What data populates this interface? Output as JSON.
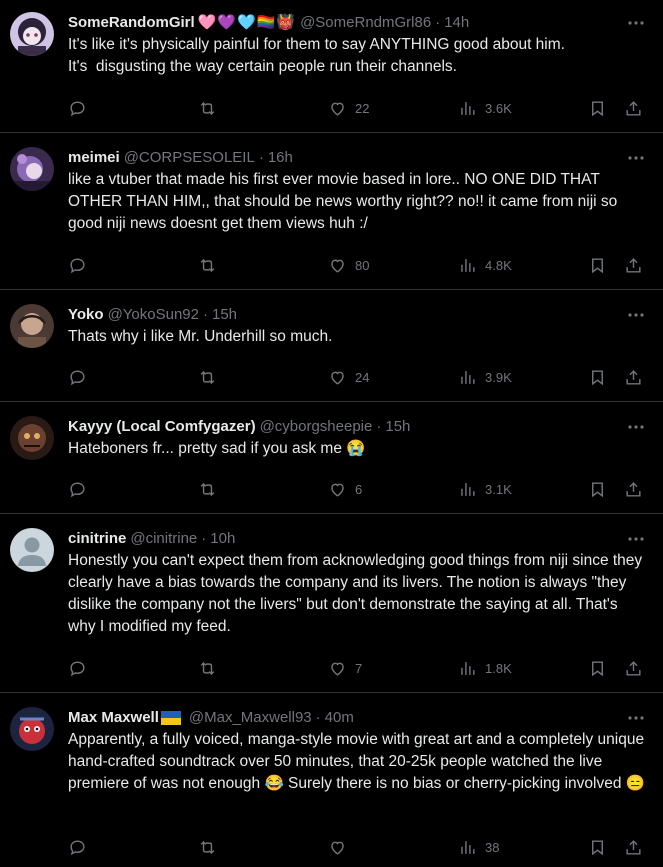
{
  "tweets": [
    {
      "name": "SomeRandomGirl",
      "name_emojis": "🩷💜🩵🏳️‍🌈👹",
      "handle": "@SomeRndmGrl86",
      "time": "14h",
      "text": "It's like it's physically painful for them to say ANYTHING good about him.\nIt's  disgusting the way certain people run their channels.",
      "replies": "",
      "retweets": "",
      "likes": "22",
      "views": "3.6K",
      "avatar_color": "#b9a7d6"
    },
    {
      "name": "meimei",
      "name_emojis": "",
      "handle": "@CORPSESOLEIL",
      "time": "16h",
      "text": "like a vtuber that made his first ever movie based in lore.. NO ONE DID THAT OTHER THAN HIM,, that should be news worthy right?? no!! it came from niji so good niji news doesnt get them views huh :/",
      "replies": "",
      "retweets": "",
      "likes": "80",
      "views": "4.8K",
      "avatar_color": "#6b4d8f"
    },
    {
      "name": "Yoko",
      "name_emojis": "",
      "handle": "@YokoSun92",
      "time": "15h",
      "text": "Thats why i like Mr. Underhill so much.",
      "replies": "",
      "retweets": "",
      "likes": "24",
      "views": "3.9K",
      "avatar_color": "#8a6a55"
    },
    {
      "name": "Kayyy (Local Comfygazer)",
      "name_emojis": "",
      "handle": "@cyborgsheepie",
      "time": "15h",
      "text": "Hateboners fr... pretty sad if you ask me 😭",
      "replies": "",
      "retweets": "",
      "likes": "6",
      "views": "3.1K",
      "avatar_color": "#5a3a30"
    },
    {
      "name": "cinitrine",
      "name_emojis": "",
      "handle": "@cinitrine",
      "time": "10h",
      "text": "Honestly you can't expect them from acknowledging good things from niji since they clearly have a bias towards the company and its livers. The notion is always \"they dislike the company not the livers\" but don't demonstrate the saying at all. That's why I modified my feed.",
      "replies": "",
      "retweets": "",
      "likes": "7",
      "views": "1.8K",
      "avatar_color": "#ccd6dd"
    },
    {
      "name": "Max Maxwell",
      "name_emojis": "",
      "handle": "@Max_Maxwell93",
      "time": "40m",
      "text": "Apparently, a fully voiced, manga-style movie with great art and a completely unique hand-crafted soundtrack over 50 minutes, that 20-25k people watched the live premiere of was not enough 😂 Surely there is no bias or cherry-picking involved 😑",
      "replies": "",
      "retweets": "",
      "likes": "",
      "views": "38",
      "avatar_color": "#2b3a6e"
    }
  ],
  "icons": {
    "reply": "reply-icon",
    "retweet": "retweet-icon",
    "like": "heart-icon",
    "views": "views-icon",
    "bookmark": "bookmark-icon",
    "share": "share-icon",
    "more": "more-icon"
  },
  "colors": {
    "background": "#000000",
    "text": "#e7e9ea",
    "muted": "#71767b",
    "divider": "#2f3336"
  }
}
